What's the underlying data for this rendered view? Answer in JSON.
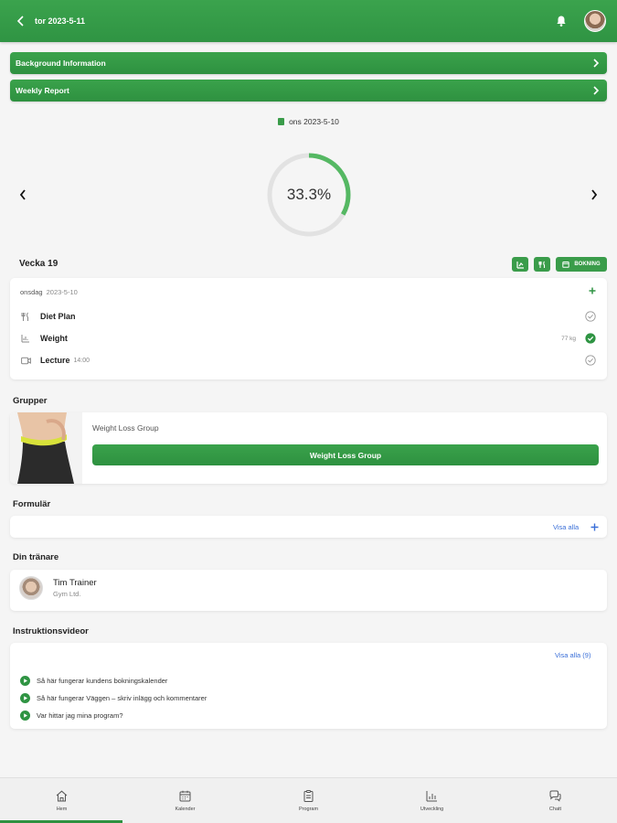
{
  "header": {
    "date": "tor 2023-5-11",
    "colors": {
      "primary": "#2f9443"
    }
  },
  "banners": [
    {
      "label": "Background Information"
    },
    {
      "label": "Weekly Report"
    }
  ],
  "progress": {
    "date": "ons 2023-5-10",
    "percent_label": "33.3%",
    "fraction": 0.333
  },
  "week": {
    "label": "Vecka 19",
    "booking_label": "BOKNING"
  },
  "day": {
    "weekday": "onsdag",
    "date": "2023-5-10",
    "tasks": [
      {
        "name": "Diet Plan",
        "sub": "",
        "value": "",
        "done": false,
        "icon": "fork-knife-icon"
      },
      {
        "name": "Weight",
        "sub": "",
        "value": "77 kg",
        "done": true,
        "icon": "chart-icon"
      },
      {
        "name": "Lecture",
        "sub": "14:00",
        "value": "",
        "done": false,
        "icon": "video-icon"
      }
    ]
  },
  "groups": {
    "title": "Grupper",
    "group_name": "Weight Loss Group",
    "button_label": "Weight Loss Group"
  },
  "forms": {
    "title": "Formulär",
    "link": "Visa alla"
  },
  "trainer": {
    "title": "Din tränare",
    "name": "Tim Trainer",
    "gym": "Gym Ltd."
  },
  "videos": {
    "title": "Instruktionsvideor",
    "link": "Visa alla (9)",
    "items": [
      "Så här fungerar kundens bokningskalender",
      "Så här fungerar Väggen – skriv inlägg och kommentarer",
      "Var hittar jag mina program?"
    ]
  },
  "nav": {
    "items": [
      "Hem",
      "Kalender",
      "Program",
      "Utveckling",
      "Chatt"
    ],
    "active": 0
  }
}
